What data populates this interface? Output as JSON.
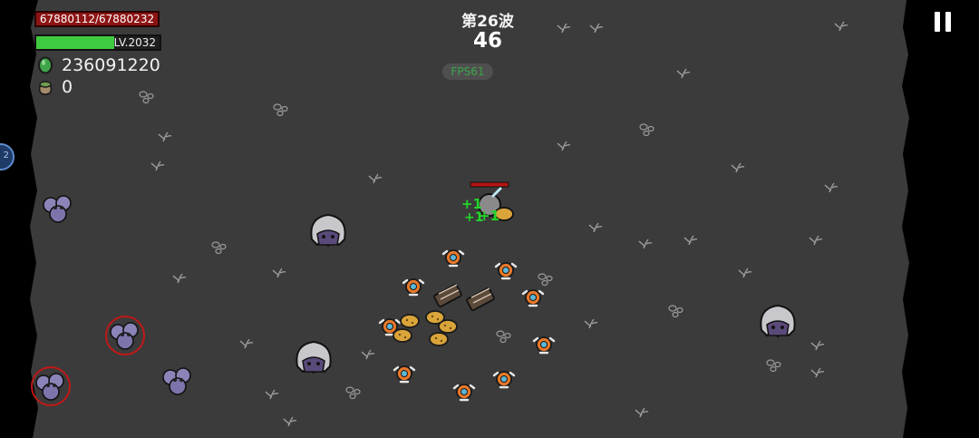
{
  "hud": {
    "hp_text": "67880112/67880232",
    "hp_current": 67880112,
    "hp_max": 67880232,
    "level_text": "LV.2032",
    "xp_fraction": 0.63,
    "coins": "236091220",
    "coin_icon": "green-gem-icon",
    "bag_count": "0",
    "bag_icon": "loot-bag-icon",
    "wave_label": "第26波",
    "timer": "46",
    "fps": "FPS61",
    "pause_icon": "pause-icon",
    "side_button_icon": "round-blue-button-icon",
    "side_button_text": "2"
  },
  "effects": {
    "heal_text": "+1",
    "heal_color": "#22d62a"
  },
  "colors": {
    "arena": "#3b3b3b",
    "hp": "#8d1414",
    "xp": "#3fcb3f",
    "elite_outline": "#c01818",
    "turret": "#e8782a"
  }
}
